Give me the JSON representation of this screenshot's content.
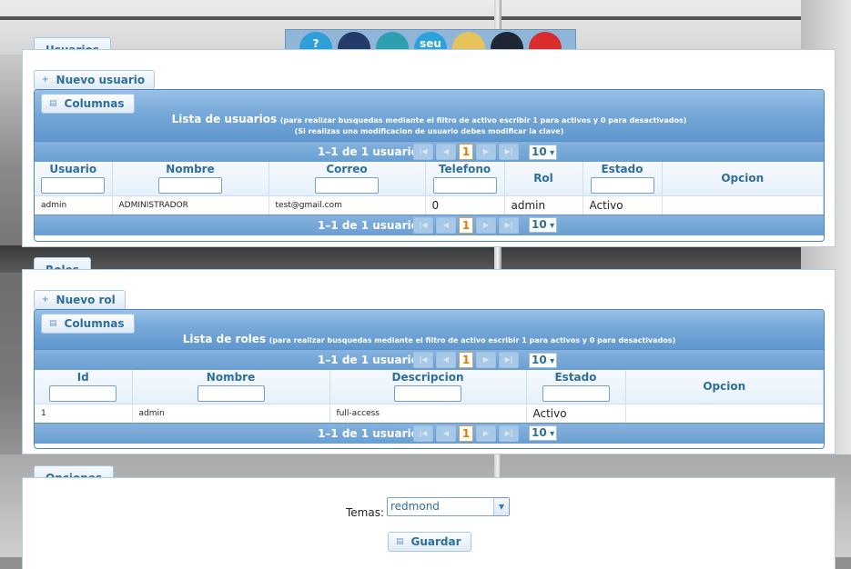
{
  "toolbar": {
    "apps": [
      {
        "icon": "help-app-icon",
        "label": "?",
        "color": "#2f9fd8"
      },
      {
        "icon": "users-app-icon",
        "label": "",
        "color": "#243a68"
      },
      {
        "icon": "calendar-app-icon",
        "label": "",
        "color": "#2e9fb0"
      },
      {
        "icon": "seu-app-icon",
        "label": "seu",
        "color": "#2aa3dd"
      },
      {
        "icon": "reports-app-icon",
        "label": "",
        "color": "#e5c35a"
      },
      {
        "icon": "group-app-icon",
        "label": "",
        "color": "#1e2733"
      },
      {
        "icon": "power-app-icon",
        "label": "",
        "color": "#d92c2c"
      }
    ]
  },
  "users": {
    "tab": "Usuarios",
    "new_button": "Nuevo usuario",
    "columns_button": "Columnas",
    "grid_title": "Lista de usuarios",
    "grid_hint": "(para realizar busquedas mediante el filtro de activo escribir 1 para activos y 0 para desactivados)",
    "grid_note": "(Si realizas una modificacion de usuario debes modificar la clave)",
    "pager": {
      "info": "1–1 de 1 usuarios",
      "page": "1",
      "rows": "10"
    },
    "columns": [
      "Usuario",
      "Nombre",
      "Correo",
      "Telefono",
      "Rol",
      "Estado",
      "Opcion"
    ],
    "rows": [
      {
        "usuario": "admin",
        "nombre": "ADMINISTRADOR",
        "correo": "test@gmail.com",
        "telefono": "0",
        "rol": "admin",
        "estado": "Activo",
        "opcion": ""
      }
    ]
  },
  "roles": {
    "tab": "Roles",
    "new_button": "Nuevo rol",
    "columns_button": "Columnas",
    "grid_title": "Lista de roles",
    "grid_hint": "(para realizar busquedas mediante el filtro de activo escribir 1 para activos y 0 para desactivados)",
    "pager": {
      "info": "1–1 de 1 usuarios",
      "page": "1",
      "rows": "10"
    },
    "columns": [
      "Id",
      "Nombre",
      "Descripcion",
      "Estado",
      "Opcion"
    ],
    "rows": [
      {
        "id": "1",
        "nombre": "admin",
        "descripcion": "full-access",
        "estado": "Activo",
        "opcion": ""
      }
    ]
  },
  "options": {
    "tab": "Opciones",
    "theme_label": "Temas:",
    "theme_value": "redmond",
    "save_button": "Guardar"
  }
}
